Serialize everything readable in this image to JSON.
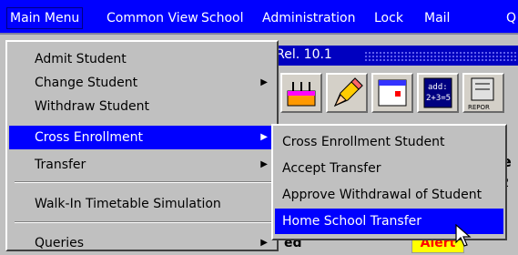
{
  "menubar": {
    "items": [
      {
        "label": "Main Menu",
        "u": "M"
      },
      {
        "label": "Common View",
        "u": "V"
      },
      {
        "label": "School",
        "u": "S"
      },
      {
        "label": "Administration",
        "u": "A"
      },
      {
        "label": "Lock",
        "u": "L"
      },
      {
        "label": "Mail",
        "u": "M"
      },
      {
        "label": "Q",
        "u": "Q"
      }
    ]
  },
  "background": {
    "release": ": Rel. 10.1",
    "calc_label": "add:\n2+3=5",
    "report_label": "REPOR",
    "partial_e": "e",
    "partial_2": "2",
    "partial_ed": "ed",
    "alert": "Alert"
  },
  "main_menu": {
    "items": [
      {
        "label": "Admit Student",
        "submenu": false
      },
      {
        "label": "Change Student",
        "submenu": true
      },
      {
        "label": "Withdraw Student",
        "submenu": false
      },
      {
        "label": "Cross Enrollment",
        "submenu": true,
        "selected": true
      },
      {
        "label": "Transfer",
        "submenu": true
      },
      {
        "label": "Walk-In Timetable Simulation",
        "submenu": false
      },
      {
        "label": "Queries",
        "submenu": true
      }
    ]
  },
  "submenu": {
    "items": [
      {
        "label": "Cross Enrollment Student"
      },
      {
        "label": "Accept Transfer"
      },
      {
        "label": "Approve Withdrawal of Student"
      },
      {
        "label": "Home School Transfer",
        "selected": true
      }
    ]
  },
  "icons": {
    "submenu_arrow": "triangle-right-icon",
    "cursor": "pointer-cursor-icon"
  }
}
